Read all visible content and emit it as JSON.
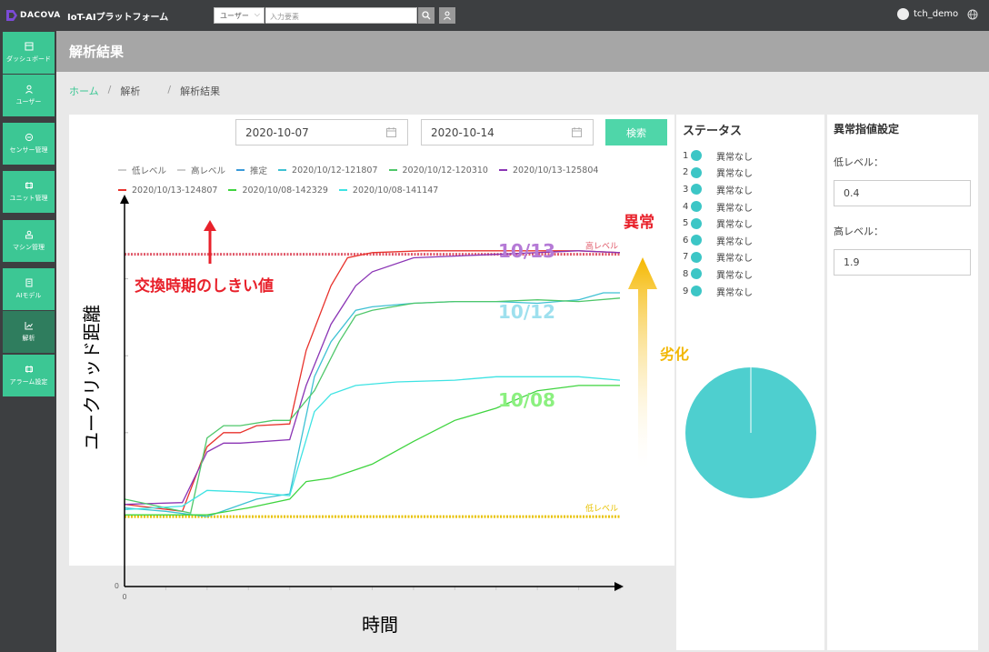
{
  "app": {
    "logo": "DACOVA",
    "title": "IoT-AIプラットフォーム"
  },
  "search": {
    "selected": "ユーザー",
    "placeholder": "入力要素"
  },
  "user": {
    "name": "tch_demo"
  },
  "sidebar": {
    "items": [
      {
        "label": "ダッシュボード",
        "icon": "dashboard-icon"
      },
      {
        "label": "ユーザー",
        "icon": "user-icon"
      },
      {
        "label": "センサー管理",
        "icon": "sensor-icon"
      },
      {
        "label": "ユニット管理",
        "icon": "unit-icon"
      },
      {
        "label": "マシン管理",
        "icon": "machine-icon"
      },
      {
        "label": "AIモデル",
        "icon": "ai-model-icon"
      },
      {
        "label": "解析",
        "icon": "analysis-icon",
        "active": true
      },
      {
        "label": "アラーム設定",
        "icon": "alarm-icon"
      }
    ]
  },
  "page": {
    "title": "解析結果"
  },
  "breadcrumb": {
    "home": "ホーム",
    "section": "解析",
    "current": "解析結果"
  },
  "filters": {
    "start_date": "2020-10-07",
    "end_date": "2020-10-14",
    "search_label": "検索"
  },
  "chart_data": {
    "type": "line",
    "legend_position": "top",
    "grid": false,
    "xlabel": "時間",
    "ylabel": "ユークリッド距離",
    "x_origin_label": "0",
    "y_origin_label": "0",
    "xlim": [
      0,
      60
    ],
    "ylim": [
      0,
      2.2
    ],
    "threshold_lines": [
      {
        "name": "低レベル",
        "value": 0.4,
        "label": "低レベル",
        "color": "#e8c200"
      },
      {
        "name": "高レベル",
        "value": 1.9,
        "label": "高レベル",
        "color": "#e05a6a"
      }
    ],
    "legend": [
      {
        "name": "低レベル",
        "color": "#cccccc"
      },
      {
        "name": "高レベル",
        "color": "#cccccc"
      },
      {
        "name": "推定",
        "color": "#3a9ad9"
      },
      {
        "name": "2020/10/12-121807",
        "color": "#3ec1d3"
      },
      {
        "name": "2020/10/12-120310",
        "color": "#4fc76a"
      },
      {
        "name": "2020/10/13-125804",
        "color": "#8b35b5"
      },
      {
        "name": "2020/10/13-124807",
        "color": "#e8322c"
      },
      {
        "name": "2020/10/08-142329",
        "color": "#3fd43f"
      },
      {
        "name": "2020/10/08-141147",
        "color": "#3ee3e3"
      }
    ],
    "series": [
      {
        "name": "2020/10/13-124807",
        "color": "#e8322c",
        "points": [
          [
            0,
            0.47
          ],
          [
            7,
            0.43
          ],
          [
            10,
            0.8
          ],
          [
            12,
            0.88
          ],
          [
            14,
            0.88
          ],
          [
            16,
            0.92
          ],
          [
            20,
            0.93
          ],
          [
            22,
            1.35
          ],
          [
            25,
            1.72
          ],
          [
            27,
            1.88
          ],
          [
            30,
            1.91
          ],
          [
            36,
            1.92
          ],
          [
            45,
            1.92
          ],
          [
            50,
            1.92
          ],
          [
            55,
            1.92
          ],
          [
            60,
            1.91
          ]
        ]
      },
      {
        "name": "2020/10/13-125804",
        "color": "#8b35b5",
        "points": [
          [
            0,
            0.47
          ],
          [
            7,
            0.48
          ],
          [
            10,
            0.77
          ],
          [
            12,
            0.82
          ],
          [
            14,
            0.82
          ],
          [
            20,
            0.84
          ],
          [
            22,
            1.15
          ],
          [
            25,
            1.5
          ],
          [
            28,
            1.72
          ],
          [
            30,
            1.8
          ],
          [
            35,
            1.88
          ],
          [
            40,
            1.89
          ],
          [
            45,
            1.9
          ],
          [
            50,
            1.91
          ],
          [
            55,
            1.92
          ],
          [
            60,
            1.91
          ]
        ]
      },
      {
        "name": "2020/10/12-121807",
        "color": "#3ec1d3",
        "points": [
          [
            0,
            0.45
          ],
          [
            5,
            0.43
          ],
          [
            10,
            0.4
          ],
          [
            13,
            0.45
          ],
          [
            16,
            0.5
          ],
          [
            20,
            0.53
          ],
          [
            23,
            1.2
          ],
          [
            25,
            1.4
          ],
          [
            28,
            1.58
          ],
          [
            30,
            1.6
          ],
          [
            35,
            1.62
          ],
          [
            40,
            1.63
          ],
          [
            45,
            1.63
          ],
          [
            50,
            1.62
          ],
          [
            55,
            1.64
          ],
          [
            58,
            1.68
          ],
          [
            60,
            1.68
          ]
        ]
      },
      {
        "name": "2020/10/12-120310",
        "color": "#4fc76a",
        "points": [
          [
            0,
            0.5
          ],
          [
            5,
            0.45
          ],
          [
            8,
            0.42
          ],
          [
            10,
            0.85
          ],
          [
            12,
            0.92
          ],
          [
            14,
            0.92
          ],
          [
            18,
            0.95
          ],
          [
            20,
            0.95
          ],
          [
            23,
            1.12
          ],
          [
            26,
            1.4
          ],
          [
            28,
            1.55
          ],
          [
            30,
            1.58
          ],
          [
            35,
            1.62
          ],
          [
            40,
            1.63
          ],
          [
            45,
            1.63
          ],
          [
            50,
            1.64
          ],
          [
            55,
            1.63
          ],
          [
            60,
            1.65
          ]
        ]
      },
      {
        "name": "2020/10/08-141147",
        "color": "#3ee3e3",
        "points": [
          [
            0,
            0.44
          ],
          [
            7,
            0.46
          ],
          [
            10,
            0.55
          ],
          [
            15,
            0.54
          ],
          [
            20,
            0.52
          ],
          [
            23,
            1.0
          ],
          [
            25,
            1.1
          ],
          [
            28,
            1.15
          ],
          [
            33,
            1.17
          ],
          [
            40,
            1.18
          ],
          [
            45,
            1.2
          ],
          [
            50,
            1.2
          ],
          [
            55,
            1.2
          ],
          [
            60,
            1.18
          ]
        ]
      },
      {
        "name": "2020/10/08-142329",
        "color": "#3fd43f",
        "points": [
          [
            0,
            0.41
          ],
          [
            10,
            0.41
          ],
          [
            15,
            0.45
          ],
          [
            20,
            0.5
          ],
          [
            22,
            0.6
          ],
          [
            25,
            0.62
          ],
          [
            30,
            0.7
          ],
          [
            35,
            0.83
          ],
          [
            40,
            0.95
          ],
          [
            45,
            1.02
          ],
          [
            50,
            1.12
          ],
          [
            55,
            1.15
          ],
          [
            60,
            1.15
          ]
        ]
      }
    ]
  },
  "annotations": {
    "anomaly": "異常",
    "threshold": "交換時期のしきい値",
    "deterioration": "劣化",
    "series_10_13": "10/13",
    "series_10_12": "10/12",
    "series_10_08": "10/08"
  },
  "status": {
    "title": "ステータス",
    "items": [
      {
        "num": "1",
        "text": "異常なし"
      },
      {
        "num": "2",
        "text": "異常なし"
      },
      {
        "num": "3",
        "text": "異常なし"
      },
      {
        "num": "4",
        "text": "異常なし"
      },
      {
        "num": "5",
        "text": "異常なし"
      },
      {
        "num": "6",
        "text": "異常なし"
      },
      {
        "num": "7",
        "text": "異常なし"
      },
      {
        "num": "8",
        "text": "異常なし"
      },
      {
        "num": "9",
        "text": "異常なし"
      }
    ],
    "pie": {
      "slices": [
        {
          "value": 100,
          "color": "#4ecfcf"
        }
      ]
    }
  },
  "thresholds": {
    "title": "異常指値設定",
    "low_label": "低レベル：",
    "low_value": "0.4",
    "high_label": "高レベル：",
    "high_value": "1.9"
  },
  "colors": {
    "accent": "#3cc794",
    "sidebar_bg": "#3d3f41",
    "header_bg": "#a6a6a6"
  }
}
